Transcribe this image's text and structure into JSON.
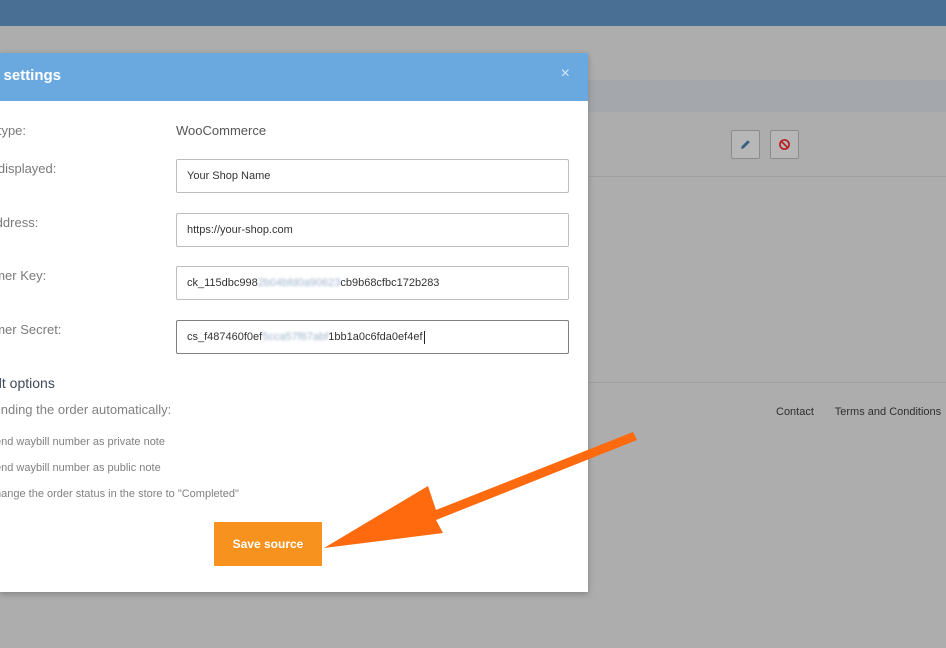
{
  "background": {
    "footer_links": [
      "Contact",
      "Terms and Conditions"
    ]
  },
  "modal": {
    "title": "e settings",
    "close_glyph": "×",
    "source_type_label": "e type:",
    "source_type_value": "WooCommerce",
    "name_label": "e displayed:",
    "name_value": "Your Shop Name",
    "address_label": "Address:",
    "address_value": "https://your-shop.com",
    "key_label": "umer Key:",
    "key_value_start": "ck_115dbc998",
    "key_value_blurred": "2b04bfd0a90623",
    "key_value_end": "cb9b68cfbc172b283",
    "secret_label": "umer Secret:",
    "secret_value_start": "cs_f487460f0ef",
    "secret_value_blurred": "5cca57f67abf",
    "secret_value_end": "1bb1a0c6fda0ef4ef",
    "section_title": "ult options",
    "section_subtitle": "sending the order automatically:",
    "options": [
      "end waybill number as private note",
      "end waybill number as public note",
      "hange the order status in the store to \"Completed\""
    ],
    "save_label": "Save source"
  },
  "colors": {
    "header": "#6aa9e0",
    "topbar": "#4a6f95",
    "save_button": "#f7921e",
    "arrow": "#ff6a0e"
  },
  "icons": [
    "close-icon",
    "pencil-icon",
    "block-icon",
    "arrow-annotation"
  ]
}
